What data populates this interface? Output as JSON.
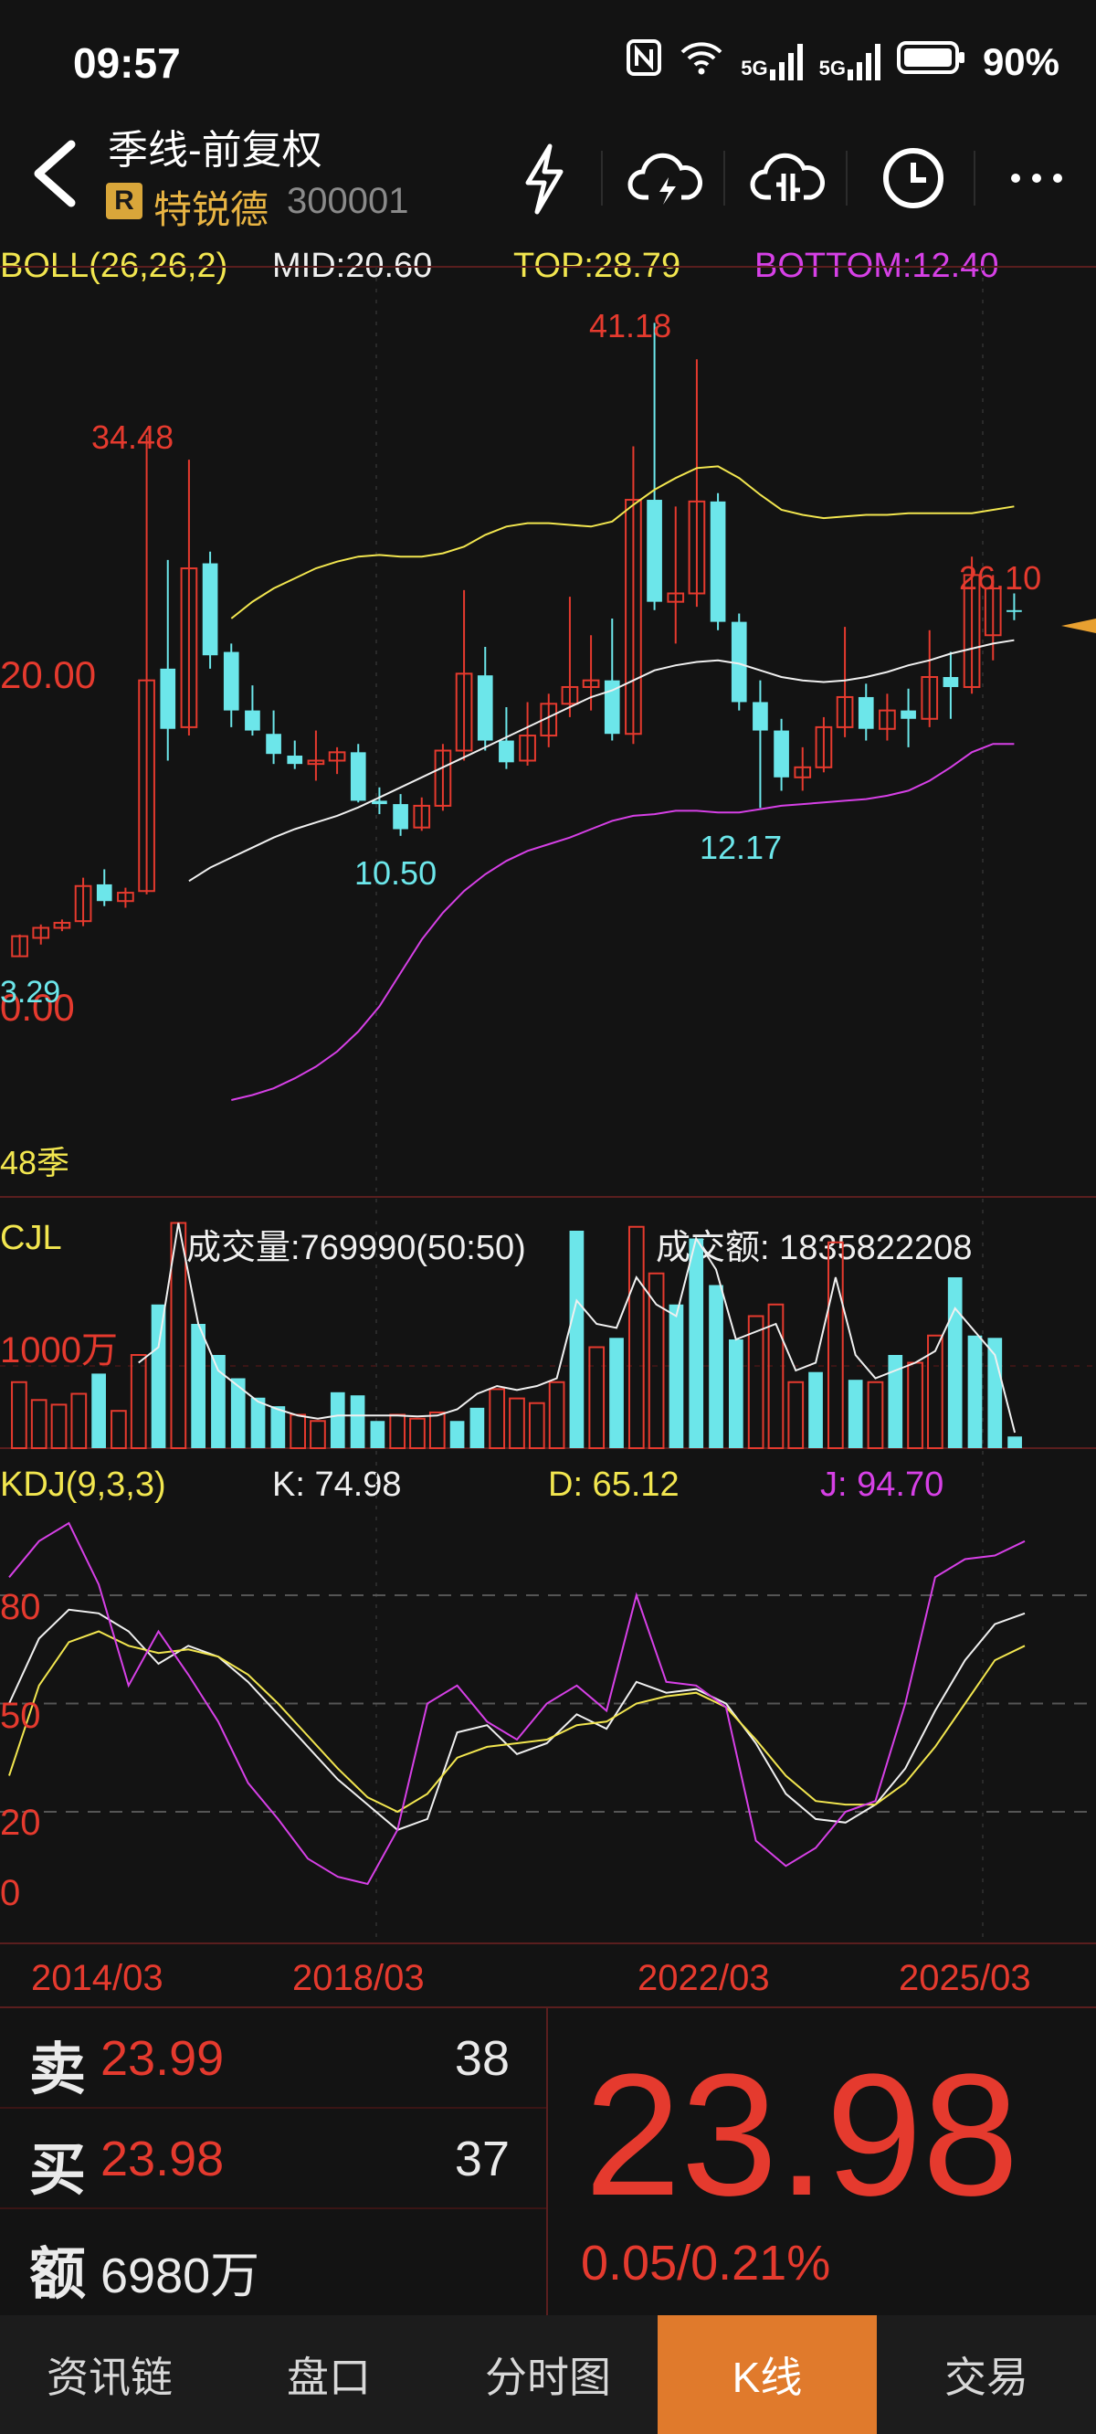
{
  "status_bar": {
    "time": "09:57",
    "battery": "90%",
    "network1": "5G",
    "network2": "5G"
  },
  "header": {
    "title": "季线-前复权",
    "badge": "R",
    "stock_name": "特锐德",
    "stock_code": "300001"
  },
  "header_icons": [
    "lightning-icon",
    "cloud-lightning-icon",
    "cloud-split-icon",
    "clock-icon",
    "more-icon"
  ],
  "boll": {
    "label": "BOLL(26,26,2)",
    "mid": "MID:20.60",
    "top": "TOP:28.79",
    "bottom": "BOTTOM:12.40"
  },
  "price_chart": {
    "y_label_20": "20.00",
    "y_label_0": "0.00",
    "period_label": "48季",
    "annotations": {
      "high1": "34.48",
      "high2": "41.18",
      "low1": "10.50",
      "low2": "12.17",
      "last_high": "26.10",
      "first_low": "3.29"
    }
  },
  "volume": {
    "label": "CJL",
    "vol": "成交量:769990(50:50)",
    "amount": "成交额: 1835822208",
    "y_label": "1000万"
  },
  "kdj": {
    "label": "KDJ(9,3,3)",
    "k": "K: 74.98",
    "d": "D: 65.12",
    "j": "J: 94.70",
    "y_labels": [
      "80",
      "50",
      "20",
      "0"
    ]
  },
  "x_axis": [
    "2014/03",
    "2018/03",
    "2022/03",
    "2025/03"
  ],
  "quote": {
    "sell_label": "卖",
    "sell_price": "23.99",
    "sell_vol": "38",
    "buy_label": "买",
    "buy_price": "23.98",
    "buy_vol": "37",
    "amount_label": "额",
    "amount_value": "6980万",
    "last_price": "23.98",
    "change": "0.05/0.21%"
  },
  "tabs": [
    {
      "label": "资讯链",
      "active": false
    },
    {
      "label": "盘口",
      "active": false
    },
    {
      "label": "分时图",
      "active": false
    },
    {
      "label": "K线",
      "active": true
    },
    {
      "label": "交易",
      "active": false
    }
  ],
  "colors": {
    "up": "#e53a2e",
    "down": "#6ce6ea",
    "mid": "#f0f0f0",
    "top": "#f2e64f",
    "bottom": "#d640e6",
    "active_tab": "#e07a2c"
  },
  "chart_data": [
    {
      "type": "candlestick",
      "title": "季线-前复权",
      "x_labels": [
        "2014/03",
        "2018/03",
        "2022/03",
        "2025/03"
      ],
      "y_ticks": [
        0,
        20
      ],
      "candles": [
        {
          "o": 3.3,
          "h": 4.6,
          "l": 3.29,
          "c": 4.5
        },
        {
          "o": 4.4,
          "h": 5.2,
          "l": 4.0,
          "c": 5.0
        },
        {
          "o": 5.0,
          "h": 5.5,
          "l": 4.8,
          "c": 5.3
        },
        {
          "o": 5.4,
          "h": 8.0,
          "l": 5.1,
          "c": 7.5
        },
        {
          "o": 7.6,
          "h": 8.5,
          "l": 6.3,
          "c": 6.6
        },
        {
          "o": 6.6,
          "h": 7.4,
          "l": 6.2,
          "c": 7.1
        },
        {
          "o": 7.2,
          "h": 34.48,
          "l": 7.0,
          "c": 19.8
        },
        {
          "o": 20.5,
          "h": 27.0,
          "l": 15.0,
          "c": 16.9
        },
        {
          "o": 17.0,
          "h": 33.0,
          "l": 16.5,
          "c": 26.5
        },
        {
          "o": 26.8,
          "h": 27.5,
          "l": 20.5,
          "c": 21.3
        },
        {
          "o": 21.5,
          "h": 22.0,
          "l": 17.0,
          "c": 18.0
        },
        {
          "o": 18.0,
          "h": 19.5,
          "l": 16.5,
          "c": 16.8
        },
        {
          "o": 16.6,
          "h": 18.0,
          "l": 14.8,
          "c": 15.4
        },
        {
          "o": 15.3,
          "h": 16.2,
          "l": 14.5,
          "c": 14.8
        },
        {
          "o": 14.8,
          "h": 16.8,
          "l": 13.8,
          "c": 15.0
        },
        {
          "o": 15.0,
          "h": 15.8,
          "l": 14.2,
          "c": 15.5
        },
        {
          "o": 15.5,
          "h": 16.0,
          "l": 12.5,
          "c": 12.6
        },
        {
          "o": 12.6,
          "h": 13.4,
          "l": 11.8,
          "c": 12.4
        },
        {
          "o": 12.4,
          "h": 13.0,
          "l": 10.5,
          "c": 10.9
        },
        {
          "o": 11.0,
          "h": 12.8,
          "l": 10.8,
          "c": 12.3
        },
        {
          "o": 12.3,
          "h": 16.0,
          "l": 12.0,
          "c": 15.6
        },
        {
          "o": 15.6,
          "h": 25.2,
          "l": 15.0,
          "c": 20.2
        },
        {
          "o": 20.1,
          "h": 21.8,
          "l": 15.6,
          "c": 16.2
        },
        {
          "o": 16.2,
          "h": 18.2,
          "l": 14.5,
          "c": 14.9
        },
        {
          "o": 15.0,
          "h": 18.5,
          "l": 14.7,
          "c": 16.5
        },
        {
          "o": 16.5,
          "h": 19.0,
          "l": 15.8,
          "c": 18.4
        },
        {
          "o": 18.4,
          "h": 24.8,
          "l": 17.6,
          "c": 19.4
        },
        {
          "o": 19.4,
          "h": 22.5,
          "l": 18.0,
          "c": 19.8
        },
        {
          "o": 19.8,
          "h": 23.5,
          "l": 16.2,
          "c": 16.6
        },
        {
          "o": 16.6,
          "h": 33.8,
          "l": 16.0,
          "c": 30.6
        },
        {
          "o": 30.6,
          "h": 41.18,
          "l": 24.0,
          "c": 24.5
        },
        {
          "o": 24.5,
          "h": 30.2,
          "l": 22.0,
          "c": 25.0
        },
        {
          "o": 25.0,
          "h": 39.0,
          "l": 24.2,
          "c": 30.5
        },
        {
          "o": 30.5,
          "h": 31.0,
          "l": 22.8,
          "c": 23.3
        },
        {
          "o": 23.3,
          "h": 23.8,
          "l": 18.0,
          "c": 18.5
        },
        {
          "o": 18.5,
          "h": 19.8,
          "l": 12.17,
          "c": 16.8
        },
        {
          "o": 16.8,
          "h": 17.5,
          "l": 13.2,
          "c": 14.0
        },
        {
          "o": 14.0,
          "h": 15.8,
          "l": 13.2,
          "c": 14.6
        },
        {
          "o": 14.6,
          "h": 17.6,
          "l": 14.3,
          "c": 17.0
        },
        {
          "o": 17.0,
          "h": 23.0,
          "l": 16.4,
          "c": 18.8
        },
        {
          "o": 18.8,
          "h": 19.6,
          "l": 16.2,
          "c": 16.9
        },
        {
          "o": 16.9,
          "h": 19.0,
          "l": 16.2,
          "c": 18.0
        },
        {
          "o": 18.0,
          "h": 19.3,
          "l": 15.8,
          "c": 17.5
        },
        {
          "o": 17.5,
          "h": 22.8,
          "l": 17.0,
          "c": 20.0
        },
        {
          "o": 20.0,
          "h": 21.5,
          "l": 17.5,
          "c": 19.4
        },
        {
          "o": 19.4,
          "h": 27.2,
          "l": 19.0,
          "c": 26.1
        },
        {
          "o": 22.5,
          "h": 26.1,
          "l": 21.0,
          "c": 25.3
        },
        {
          "o": 24.0,
          "h": 25.0,
          "l": 23.4,
          "c": 23.98
        }
      ],
      "boll_mid": [
        null,
        null,
        null,
        null,
        null,
        null,
        null,
        null,
        7.8,
        8.6,
        9.2,
        9.8,
        10.4,
        10.9,
        11.3,
        11.7,
        12.2,
        12.8,
        13.4,
        14.0,
        14.6,
        15.2,
        15.8,
        16.4,
        17.0,
        17.6,
        18.2,
        18.8,
        19.2,
        19.8,
        20.4,
        20.7,
        20.9,
        21.0,
        20.8,
        20.4,
        20.0,
        19.8,
        19.7,
        19.8,
        20.0,
        20.3,
        20.7,
        21.0,
        21.4,
        21.7,
        22.0,
        22.2
      ],
      "boll_top": [
        null,
        null,
        null,
        null,
        null,
        null,
        null,
        null,
        null,
        null,
        23.5,
        24.5,
        25.3,
        25.9,
        26.5,
        26.9,
        27.2,
        27.3,
        27.2,
        27.2,
        27.4,
        27.8,
        28.5,
        29.0,
        29.2,
        29.2,
        29.1,
        29.0,
        29.3,
        30.3,
        31.2,
        31.9,
        32.5,
        32.6,
        31.9,
        30.9,
        30.0,
        29.7,
        29.5,
        29.6,
        29.7,
        29.7,
        29.8,
        29.8,
        29.8,
        29.8,
        30.0,
        30.2
      ],
      "boll_bottom": [
        null,
        null,
        null,
        null,
        null,
        null,
        null,
        null,
        null,
        null,
        -5.3,
        -5.0,
        -4.6,
        -4.0,
        -3.3,
        -2.4,
        -1.2,
        0.3,
        2.3,
        4.3,
        5.9,
        7.2,
        8.2,
        9.0,
        9.6,
        10.0,
        10.4,
        10.9,
        11.4,
        11.7,
        11.8,
        12.0,
        12.0,
        11.9,
        11.9,
        12.1,
        12.3,
        12.4,
        12.5,
        12.6,
        12.7,
        12.9,
        13.2,
        13.8,
        14.6,
        15.5,
        16.0,
        16.0
      ]
    },
    {
      "type": "bar",
      "title": "CJL",
      "y_ticks": [
        1000
      ],
      "y_unit": "万",
      "values": [
        850,
        620,
        560,
        700,
        960,
        480,
        1200,
        1850,
        2900,
        1600,
        1200,
        900,
        650,
        540,
        430,
        350,
        720,
        680,
        350,
        430,
        380,
        460,
        350,
        520,
        760,
        640,
        580,
        850,
        2800,
        1300,
        1420,
        2850,
        2250,
        1850,
        2700,
        2100,
        1400,
        1700,
        1850,
        850,
        980,
        2650,
        880,
        850,
        1200,
        1100,
        1450,
        2200,
        1450,
        1420,
        150
      ],
      "line": [
        null,
        null,
        null,
        null,
        null,
        null,
        1100,
        1300,
        2900,
        1600,
        1000,
        800,
        600,
        500,
        420,
        380,
        420,
        420,
        420,
        420,
        410,
        420,
        500,
        700,
        800,
        750,
        800,
        900,
        1900,
        1600,
        1550,
        2200,
        1850,
        1700,
        2700,
        2300,
        1400,
        1500,
        1600,
        1000,
        1100,
        2200,
        1200,
        900,
        1000,
        1100,
        1250,
        1800,
        1500,
        1200,
        200
      ]
    },
    {
      "type": "line",
      "title": "KDJ(9,3,3)",
      "y_ticks": [
        0,
        20,
        50,
        80
      ],
      "series": [
        {
          "name": "K",
          "color": "#f0f0f0",
          "values": [
            50,
            68,
            76,
            75,
            70,
            61,
            66,
            63,
            56,
            47,
            38,
            29,
            22,
            15,
            18,
            42,
            44,
            36,
            39,
            47,
            43,
            56,
            53,
            54,
            50,
            39,
            25,
            18,
            17,
            22,
            32,
            48,
            62,
            72,
            75
          ]
        },
        {
          "name": "D",
          "color": "#f2e64f",
          "values": [
            30,
            55,
            67,
            70,
            66,
            64,
            65,
            63,
            58,
            50,
            41,
            32,
            24,
            20,
            25,
            35,
            38,
            39,
            40,
            44,
            45,
            50,
            52,
            53,
            49,
            40,
            30,
            23,
            22,
            22,
            28,
            38,
            50,
            62,
            66
          ]
        },
        {
          "name": "J",
          "color": "#d640e6",
          "values": [
            85,
            95,
            100,
            83,
            55,
            70,
            58,
            45,
            28,
            18,
            7,
            2,
            0,
            15,
            50,
            55,
            45,
            40,
            50,
            55,
            48,
            80,
            56,
            55,
            49,
            12,
            5,
            10,
            20,
            23,
            50,
            85,
            90,
            91,
            95
          ]
        }
      ]
    }
  ]
}
